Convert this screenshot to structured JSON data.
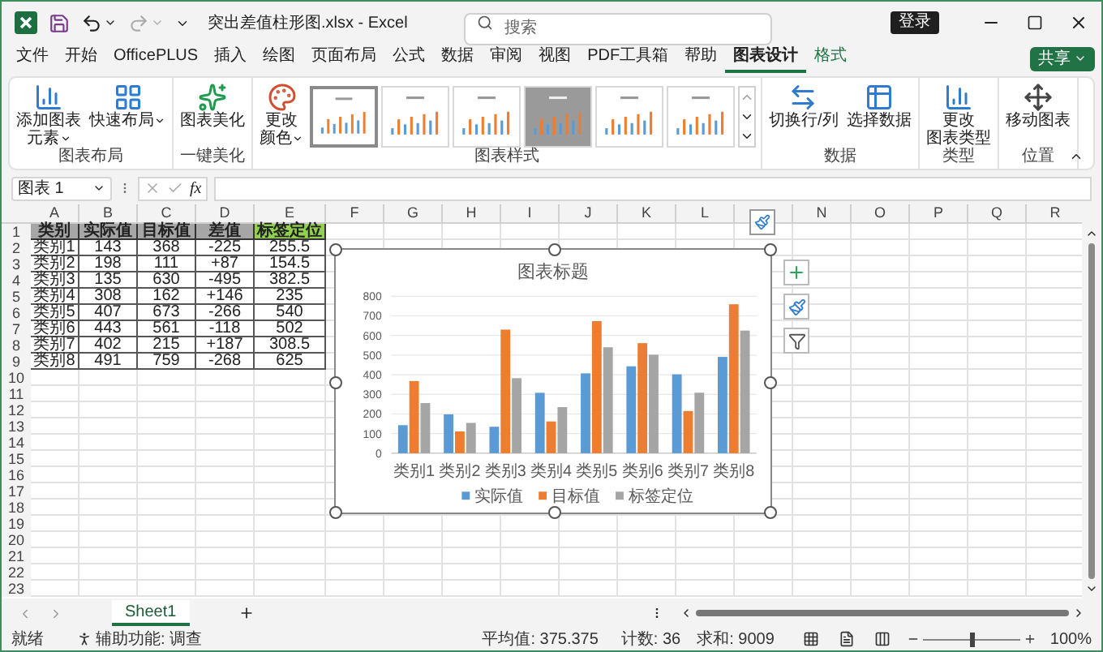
{
  "window": {
    "title": "突出差值柱形图.xlsx - Excel"
  },
  "search": {
    "placeholder": "搜索"
  },
  "login_button": "登录",
  "menu_tabs": [
    {
      "label": "文件",
      "selected": false,
      "kind": "normal"
    },
    {
      "label": "开始",
      "selected": false,
      "kind": "normal"
    },
    {
      "label": "OfficePLUS",
      "selected": false,
      "kind": "normal"
    },
    {
      "label": "插入",
      "selected": false,
      "kind": "normal"
    },
    {
      "label": "绘图",
      "selected": false,
      "kind": "normal"
    },
    {
      "label": "页面布局",
      "selected": false,
      "kind": "normal"
    },
    {
      "label": "公式",
      "selected": false,
      "kind": "normal"
    },
    {
      "label": "数据",
      "selected": false,
      "kind": "normal"
    },
    {
      "label": "审阅",
      "selected": false,
      "kind": "normal"
    },
    {
      "label": "视图",
      "selected": false,
      "kind": "normal"
    },
    {
      "label": "PDF工具箱",
      "selected": false,
      "kind": "normal"
    },
    {
      "label": "帮助",
      "selected": false,
      "kind": "normal"
    },
    {
      "label": "图表设计",
      "selected": true,
      "kind": "normal"
    },
    {
      "label": "格式",
      "selected": false,
      "kind": "contextual"
    }
  ],
  "share_button": "共享",
  "ribbon": {
    "groups": [
      {
        "label": "图表布局",
        "items": [
          {
            "kind": "button",
            "lines": [
              "添加图表",
              "元素"
            ],
            "dropdown": true
          },
          {
            "kind": "button",
            "lines": [
              "快速布局"
            ],
            "dropdown": true
          }
        ]
      },
      {
        "label": "一键美化",
        "items": [
          {
            "kind": "button",
            "lines": [
              "图表美化"
            ],
            "dropdown": false
          }
        ]
      },
      {
        "label": "图表样式",
        "items": [
          {
            "kind": "button",
            "lines": [
              "更改",
              "颜色"
            ],
            "dropdown": true
          },
          {
            "kind": "gallery",
            "thumbnails": [
              {
                "kind": "plain",
                "selected": true
              },
              {
                "kind": "plain",
                "selected": false
              },
              {
                "kind": "plain",
                "selected": false
              },
              {
                "kind": "shaded",
                "selected": false
              },
              {
                "kind": "plain",
                "selected": false
              },
              {
                "kind": "plain",
                "selected": false
              }
            ]
          }
        ]
      },
      {
        "label": "数据",
        "items": [
          {
            "kind": "button",
            "lines": [
              "切换行/列"
            ],
            "dropdown": false
          },
          {
            "kind": "button",
            "lines": [
              "选择数据"
            ],
            "dropdown": false
          }
        ]
      },
      {
        "label": "类型",
        "items": [
          {
            "kind": "button",
            "lines": [
              "更改",
              "图表类型"
            ],
            "dropdown": false
          }
        ]
      },
      {
        "label": "位置",
        "items": [
          {
            "kind": "button",
            "lines": [
              "移动图表"
            ],
            "dropdown": false
          }
        ]
      }
    ]
  },
  "formula_bar": {
    "name_box": "图表 1",
    "fx": "fx"
  },
  "sheet": {
    "column_headers_left": [
      "A",
      "B",
      "C",
      "D",
      "E",
      "F",
      "G",
      "H",
      "I",
      "J",
      "K",
      "L"
    ],
    "column_headers_right": [
      "N",
      "O",
      "P",
      "Q",
      "R"
    ],
    "row_numbers": [
      "1",
      "2",
      "3",
      "4",
      "5",
      "6",
      "7",
      "8",
      "9",
      "10",
      "11",
      "12",
      "13",
      "14",
      "15",
      "16",
      "17",
      "18",
      "19",
      "20",
      "21",
      "22",
      "23"
    ]
  },
  "table": {
    "columns": [
      {
        "label": "类别",
        "color": "#a6a6a6"
      },
      {
        "label": "实际值",
        "color": "#a6a6a6"
      },
      {
        "label": "目标值",
        "color": "#a6a6a6"
      },
      {
        "label": "差值",
        "color": "#a6a6a6"
      },
      {
        "label": "标签定位",
        "color": "#92d050"
      }
    ],
    "rows": [
      [
        "类别1",
        "143",
        "368",
        "-225",
        "255.5"
      ],
      [
        "类别2",
        "198",
        "111",
        "+87",
        "154.5"
      ],
      [
        "类别3",
        "135",
        "630",
        "-495",
        "382.5"
      ],
      [
        "类别4",
        "308",
        "162",
        "+146",
        "235"
      ],
      [
        "类别5",
        "407",
        "673",
        "-266",
        "540"
      ],
      [
        "类别6",
        "443",
        "561",
        "-118",
        "502"
      ],
      [
        "类别7",
        "402",
        "215",
        "+187",
        "308.5"
      ],
      [
        "类别8",
        "491",
        "759",
        "-268",
        "625"
      ]
    ]
  },
  "chart_data": {
    "type": "bar",
    "title": "图表标题",
    "categories": [
      "类别1",
      "类别2",
      "类别3",
      "类别4",
      "类别5",
      "类别6",
      "类别7",
      "类别8"
    ],
    "series": [
      {
        "name": "实际值",
        "color": "#5b9bd5",
        "values": [
          143,
          198,
          135,
          308,
          407,
          443,
          402,
          491
        ]
      },
      {
        "name": "目标值",
        "color": "#ed7d31",
        "values": [
          368,
          111,
          630,
          162,
          673,
          561,
          215,
          759
        ]
      },
      {
        "name": "标签定位",
        "color": "#a5a5a5",
        "values": [
          255.5,
          154.5,
          382.5,
          235,
          540,
          502,
          308.5,
          625
        ]
      }
    ],
    "ylim": [
      0,
      800
    ],
    "yticks": [
      0,
      100,
      200,
      300,
      400,
      500,
      600,
      700,
      800
    ],
    "grid": true,
    "legend": true
  },
  "sheet_tabs": [
    {
      "label": "Sheet1",
      "selected": true
    }
  ],
  "status_bar": {
    "ready": "就绪",
    "accessibility": "辅助功能: 调查",
    "average": "平均值: 375.375",
    "count": "计数: 36",
    "sum": "求和: 9009",
    "zoom": "100%",
    "zoom_level": {
      "level": 0.5
    }
  }
}
